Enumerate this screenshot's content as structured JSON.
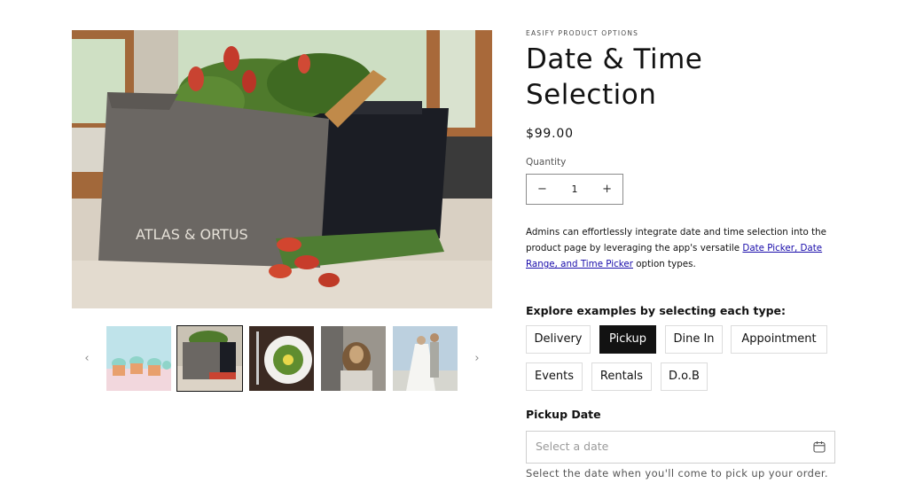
{
  "product": {
    "vendor": "EASIFY PRODUCT OPTIONS",
    "title": "Date & Time Selection",
    "price": "$99.00",
    "image_bag_text": "ATLAS & ORTUS"
  },
  "quantity": {
    "label": "Quantity",
    "value": "1",
    "minus": "−",
    "plus": "+"
  },
  "description": {
    "text_before": "Admins can effortlessly integrate date and time selection into the product page by leveraging the app's versatile ",
    "link_text": "Date Picker, Date Range, and Time Picker",
    "text_after": " option types."
  },
  "explore_heading": "Explore examples by selecting each type:",
  "options": [
    "Delivery",
    "Pickup",
    "Dine In",
    "Appointment",
    "Events",
    "Rentals",
    "D.o.B"
  ],
  "selected_option": "Pickup",
  "pickup": {
    "label": "Pickup Date",
    "placeholder": "Select a date",
    "help": "Select the date when you'll come to pick up your order."
  },
  "gallery": {
    "prev": "‹",
    "next": "›",
    "thumbnails": [
      "cupcakes",
      "tote-bag-flowers",
      "salad-plate",
      "dog",
      "wedding-couple"
    ],
    "selected_thumbnail": "tote-bag-flowers"
  },
  "colors": {
    "accent": "#121212",
    "link": "#1a0dab",
    "border": "#dcdcdc"
  }
}
